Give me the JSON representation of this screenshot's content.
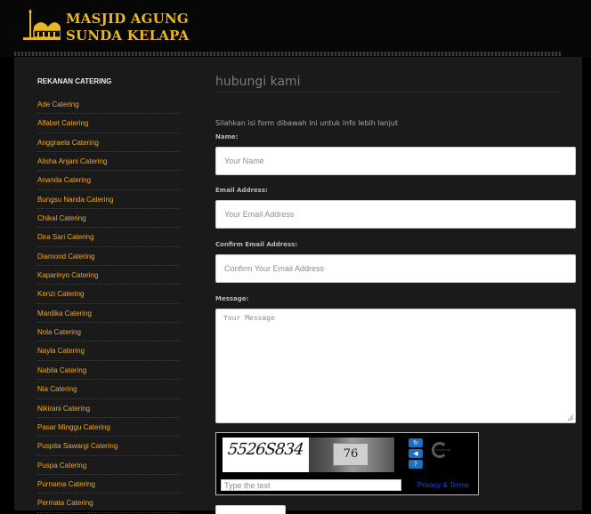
{
  "site": {
    "logo_line1": "MASJID AGUNG",
    "logo_line2": "SUNDA KELAPA"
  },
  "sidebar": {
    "title": "REKANAN CATERING",
    "items": [
      "Ade Catering",
      "Alfabet Catering",
      "Anggraela Catering",
      "Alisha Anjani Catering",
      "Ananda Catering",
      "Bungsu Nanda Catering",
      "Chikal Catering",
      "Dira Sari Catering",
      "Diamond Catering",
      "Kaparinyo Catering",
      "Kenzi Catering",
      "Mardika Catering",
      "Nola Catering",
      "Nayla Catering",
      "Nabila Catering",
      "Nia Catering",
      "Nikirani Catering",
      "Pasar Minggu Catering",
      "Puspita Sawargi Catering",
      "Puspa Catering",
      "Purnama Catering",
      "Permata Catering"
    ]
  },
  "contact": {
    "title": "hubungi kami",
    "intro": "Silahkan isi form dibawah ini untuk info lebih lanjut",
    "name_label": "Name:",
    "name_placeholder": "Your Name",
    "email_label": "Email Address:",
    "email_placeholder": "Your Email Address",
    "confirm_label": "Confirm Email Address:",
    "confirm_placeholder": "Confirm Your Email Address",
    "message_label": "Message:",
    "message_placeholder": "Your Message"
  },
  "captcha": {
    "code": "5526S834",
    "photo_number": "76",
    "input_placeholder": "Type the text",
    "links": "Privacy & Terms"
  },
  "colors": {
    "accent": "#f0a820",
    "logo": "#e8b822",
    "panel": "#1a1a1a",
    "link_blue": "#1644ff"
  }
}
